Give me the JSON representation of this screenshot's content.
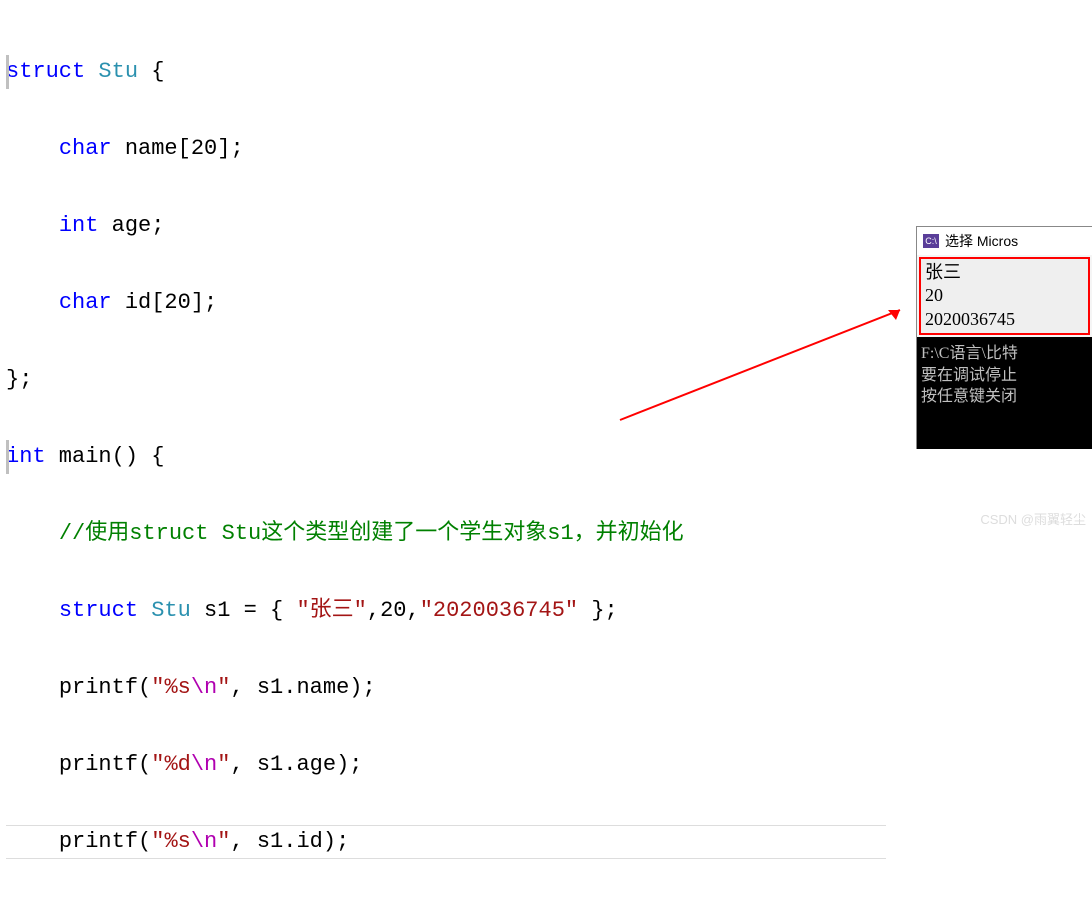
{
  "code": {
    "l1_struct": "struct",
    "l1_type": " Stu",
    "l1_rest": " {",
    "l2_indent": "    ",
    "l2_char": "char",
    "l2_rest": " name[20];",
    "l3_indent": "    ",
    "l3_int": "int",
    "l3_rest": " age;",
    "l4_indent": "    ",
    "l4_char": "char",
    "l4_rest": " id[20];",
    "l5": "};",
    "l6_int": "int",
    "l6_rest": " main() {",
    "l7_indent": "    ",
    "l7_comment": "//使用struct Stu这个类型创建了一个学生对象s1，并初始化",
    "l8_indent": "    ",
    "l8_struct": "struct",
    "l8_type": " Stu",
    "l8_mid": " s1 = { ",
    "l8_str1": "\"张三\"",
    "l8_mid2": ",20,",
    "l8_str2": "\"2020036745\"",
    "l8_end": " };",
    "l9_indent": "    ",
    "l9_pre": "printf(",
    "l9_q1": "\"",
    "l9_fmt": "%s",
    "l9_esc": "\\n",
    "l9_q2": "\"",
    "l9_post": ", s1.name);",
    "l10_indent": "    ",
    "l10_pre": "printf(",
    "l10_q1": "\"",
    "l10_fmt": "%d",
    "l10_esc": "\\n",
    "l10_q2": "\"",
    "l10_post": ", s1.age);",
    "l11_indent": "    ",
    "l11_pre": "printf(",
    "l11_q1": "\"",
    "l11_fmt": "%s",
    "l11_esc": "\\n",
    "l11_q2": "\"",
    "l11_post": ", s1.id);"
  },
  "console": {
    "title": "选择 Micros",
    "icon_text": "C:\\",
    "output_line1": "张三",
    "output_line2": "20",
    "output_line3": "2020036745",
    "black_line1": "F:\\C语言\\比特",
    "black_line2": "要在调试停止",
    "black_line3": "按任意键关闭"
  },
  "watermark": "CSDN @雨翼轻尘"
}
